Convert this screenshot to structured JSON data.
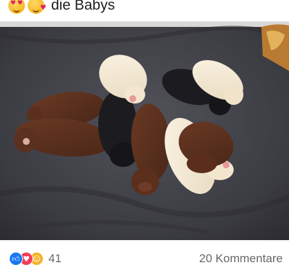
{
  "post": {
    "caption_text": "die Babys",
    "caption_emojis": [
      "heart-eyes-emoji",
      "smiling-face-with-hearts-emoji"
    ],
    "image_alt": "Welpen",
    "reactions": {
      "types": [
        "like-icon",
        "love-icon",
        "care-icon"
      ],
      "count": "41"
    },
    "comments_label": "20 Kommentare"
  },
  "colors": {
    "like": "#1877f2",
    "love": "#f33e58",
    "care": "#f7b125",
    "meta_text": "#65676b",
    "caption_text": "#1c1e21"
  }
}
